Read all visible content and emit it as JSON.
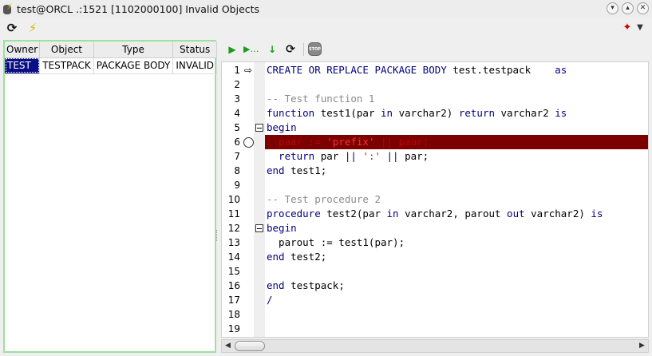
{
  "window": {
    "title": "test@ORCL .:1521 [1102000100] Invalid Objects",
    "buttons": [
      "v",
      "^",
      "x"
    ]
  },
  "top_toolbar": {
    "refresh_icon": "refresh-icon",
    "bolt_icon": "lightning-icon",
    "wand_icon": "magic-wand-icon",
    "menu_arrow": "chevron-down-icon"
  },
  "objects_table": {
    "headers": [
      "Owner",
      "Object",
      "Type",
      "Status"
    ],
    "rows": [
      [
        "TEST",
        "TESTPACK",
        "PACKAGE BODY",
        "INVALID"
      ]
    ]
  },
  "editor_toolbar": {
    "icons": [
      "run-icon",
      "step-over-icon",
      "step-into-icon",
      "refresh-icon",
      "stop-icon"
    ],
    "stop_label": "STOP"
  },
  "editor": {
    "error_line": 6,
    "line_numbers": [
      "1",
      "2",
      "3",
      "4",
      "5",
      "6",
      "7",
      "8",
      "9",
      "10",
      "11",
      "12",
      "13",
      "14",
      "15",
      "16",
      "17",
      "18",
      "19"
    ],
    "lines": [
      [
        {
          "t": "CREATE OR REPLACE PACKAGE BODY ",
          "c": "kw"
        },
        {
          "t": "test.testpack",
          "c": "idf"
        },
        {
          "t": "    as",
          "c": "kw"
        }
      ],
      [],
      [
        {
          "t": "-- Test function 1",
          "c": "cm"
        }
      ],
      [
        {
          "t": "function ",
          "c": "kw"
        },
        {
          "t": "test1(par ",
          "c": "idf"
        },
        {
          "t": "in ",
          "c": "kw"
        },
        {
          "t": "varchar2) ",
          "c": "idf"
        },
        {
          "t": "return ",
          "c": "kw"
        },
        {
          "t": "varchar2 ",
          "c": "idf"
        },
        {
          "t": "is",
          "c": "kw"
        }
      ],
      [
        {
          "t": "begin",
          "c": "kw"
        }
      ],
      [
        {
          "t": "  paar := ",
          "c": "idf"
        },
        {
          "t": "'prefix'",
          "c": "str"
        },
        {
          "t": " || ",
          "c": "kw"
        },
        {
          "t": "paar;",
          "c": "idf"
        }
      ],
      [
        {
          "t": "  return ",
          "c": "kw"
        },
        {
          "t": "par ",
          "c": "idf"
        },
        {
          "t": "|| ",
          "c": "kw"
        },
        {
          "t": "':'",
          "c": "str"
        },
        {
          "t": " || ",
          "c": "kw"
        },
        {
          "t": "par;",
          "c": "idf"
        }
      ],
      [
        {
          "t": "end ",
          "c": "kw"
        },
        {
          "t": "test1;",
          "c": "idf"
        }
      ],
      [],
      [
        {
          "t": "-- Test procedure 2",
          "c": "cm"
        }
      ],
      [
        {
          "t": "procedure ",
          "c": "kw"
        },
        {
          "t": "test2(par ",
          "c": "idf"
        },
        {
          "t": "in ",
          "c": "kw"
        },
        {
          "t": "varchar2, parout ",
          "c": "idf"
        },
        {
          "t": "out ",
          "c": "kw"
        },
        {
          "t": "varchar2) ",
          "c": "idf"
        },
        {
          "t": "is",
          "c": "kw"
        }
      ],
      [
        {
          "t": "begin",
          "c": "kw"
        }
      ],
      [
        {
          "t": "  parout := test1(par);",
          "c": "idf"
        }
      ],
      [
        {
          "t": "end ",
          "c": "kw"
        },
        {
          "t": "test2;",
          "c": "idf"
        }
      ],
      [],
      [
        {
          "t": "end ",
          "c": "kw"
        },
        {
          "t": "testpack;",
          "c": "idf"
        }
      ],
      [
        {
          "t": "/",
          "c": "kw"
        }
      ],
      [],
      []
    ],
    "fold_lines": [
      5,
      12
    ],
    "breakpoint_line": 6,
    "exec_arrow_line": 1
  },
  "scrollbar": {
    "left_arrow": "◀",
    "right_arrow": "▶"
  }
}
